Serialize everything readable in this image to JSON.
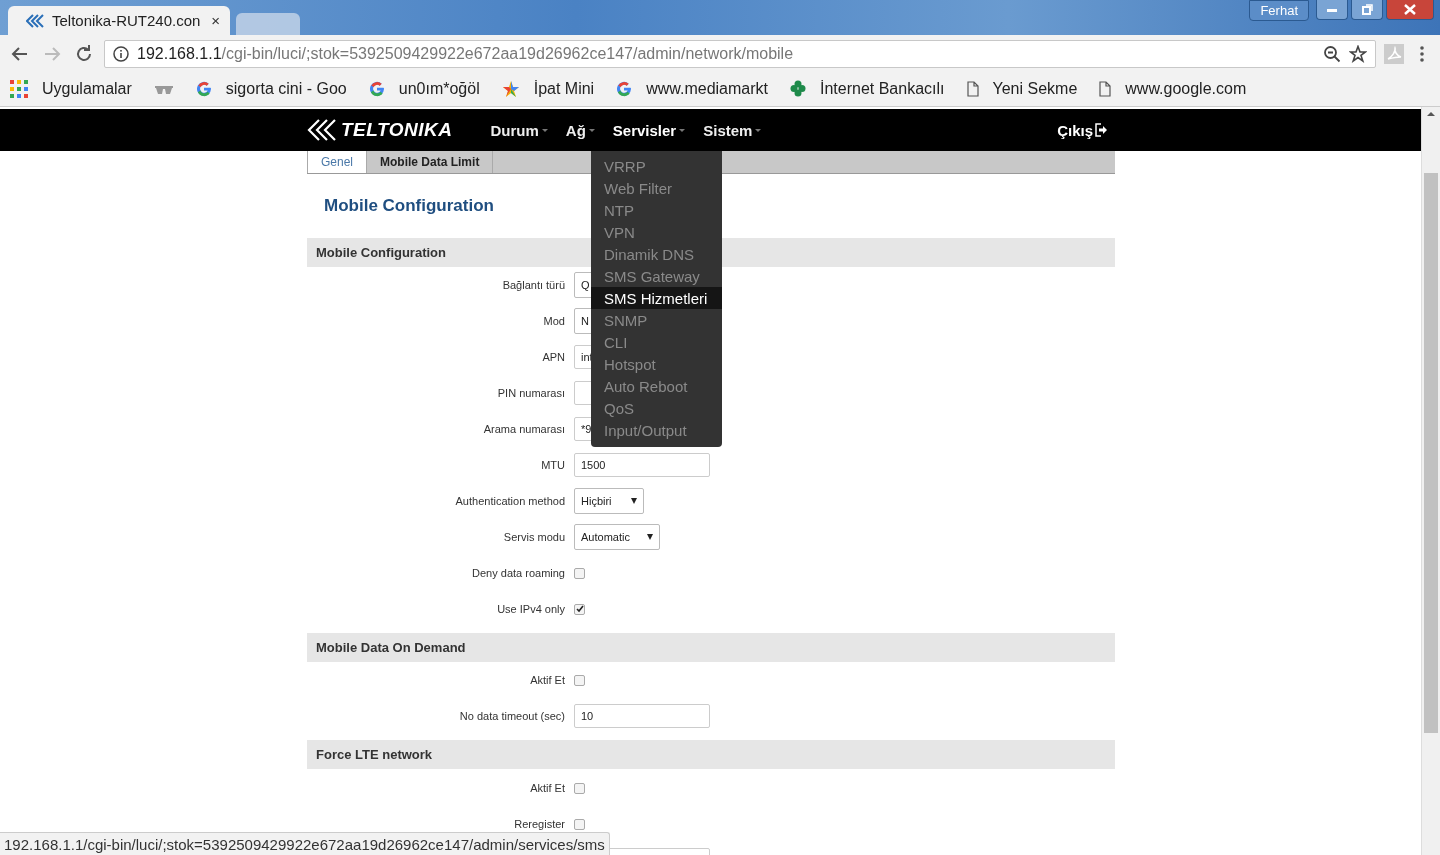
{
  "browser": {
    "tabs": [
      {
        "title": "Teltonika-RUT240.con",
        "close": "×",
        "selected": true
      },
      {
        "selected": false
      }
    ],
    "profile": "Ferhat",
    "url_host": "192.168.1.1",
    "url_path": "/cgi-bin/luci/;stok=5392509429922e672aa19d26962ce147/admin/network/mobile",
    "bookmarks": [
      {
        "kind": "apps",
        "label": "Uygulamalar"
      },
      {
        "kind": "glasses"
      },
      {
        "kind": "google",
        "label": "sigorta cini - Goo"
      },
      {
        "kind": "google",
        "label": "un0ım*oğöl"
      },
      {
        "kind": "star",
        "label": "İpat Mini"
      },
      {
        "kind": "google",
        "label": "www.mediamarkt"
      },
      {
        "kind": "clover",
        "label": "İnternet Bankacılı"
      },
      {
        "kind": "page",
        "label": "Yeni Sekme"
      },
      {
        "kind": "page",
        "label": "www.google.com"
      }
    ]
  },
  "navbar": {
    "logo": "TELTONIKA",
    "items": [
      {
        "label": "Durum",
        "expanded": false
      },
      {
        "label": "Ağ",
        "expanded": false
      },
      {
        "label": "Servisler",
        "expanded": true
      },
      {
        "label": "Sistem",
        "expanded": false
      }
    ],
    "logout": "Çıkış"
  },
  "services_menu": [
    {
      "label": "VRRP",
      "selected": false
    },
    {
      "label": "Web Filter",
      "selected": false
    },
    {
      "label": "NTP",
      "selected": false
    },
    {
      "label": "VPN",
      "selected": false
    },
    {
      "label": "Dinamik DNS",
      "selected": false
    },
    {
      "label": "SMS Gateway",
      "selected": false
    },
    {
      "label": "SMS Hizmetleri",
      "selected": true
    },
    {
      "label": "SNMP",
      "selected": false
    },
    {
      "label": "CLI",
      "selected": false
    },
    {
      "label": "Hotspot",
      "selected": false
    },
    {
      "label": "Auto Reboot",
      "selected": false
    },
    {
      "label": "QoS",
      "selected": false
    },
    {
      "label": "Input/Output",
      "selected": false
    }
  ],
  "tabs": [
    {
      "label": "Genel",
      "selected": true
    },
    {
      "label": "Mobile Data Limit",
      "selected": false
    }
  ],
  "page_title": "Mobile Configuration",
  "sections": [
    {
      "title": "Mobile Configuration",
      "rows": [
        {
          "label": "Bağlantı türü",
          "kind": "select",
          "value": "Q"
        },
        {
          "label": "Mod",
          "kind": "select",
          "value": "N"
        },
        {
          "label": "APN",
          "kind": "text",
          "value": "int"
        },
        {
          "label": "PIN numarası",
          "kind": "text"
        },
        {
          "label": "Arama numarası",
          "kind": "text",
          "value": "*9"
        },
        {
          "label": "MTU",
          "kind": "text",
          "value": "1500"
        },
        {
          "label": "Authentication method",
          "kind": "select",
          "value": "Hiçbiri"
        },
        {
          "label": "Servis modu",
          "kind": "select",
          "value": "Automatic"
        },
        {
          "label": "Deny data roaming",
          "kind": "checkbox",
          "checked": false
        },
        {
          "label": "Use IPv4 only",
          "kind": "checkbox",
          "checked": true
        }
      ]
    },
    {
      "title": "Mobile Data On Demand",
      "rows": [
        {
          "label": "Aktif Et",
          "kind": "checkbox",
          "checked": false
        },
        {
          "label": "No data timeout (sec)",
          "kind": "text",
          "value": "10"
        }
      ]
    },
    {
      "title": "Force LTE network",
      "rows": [
        {
          "label": "Aktif Et",
          "kind": "checkbox",
          "checked": false
        },
        {
          "label": "Reregister",
          "kind": "checkbox",
          "checked": false
        },
        {
          "kind": "text"
        }
      ]
    }
  ],
  "status_bar": {
    "url": "192.168.1.1/cgi-bin/luci/;stok=5392509429922e672aa19d26962ce147/admin/services/sms"
  }
}
